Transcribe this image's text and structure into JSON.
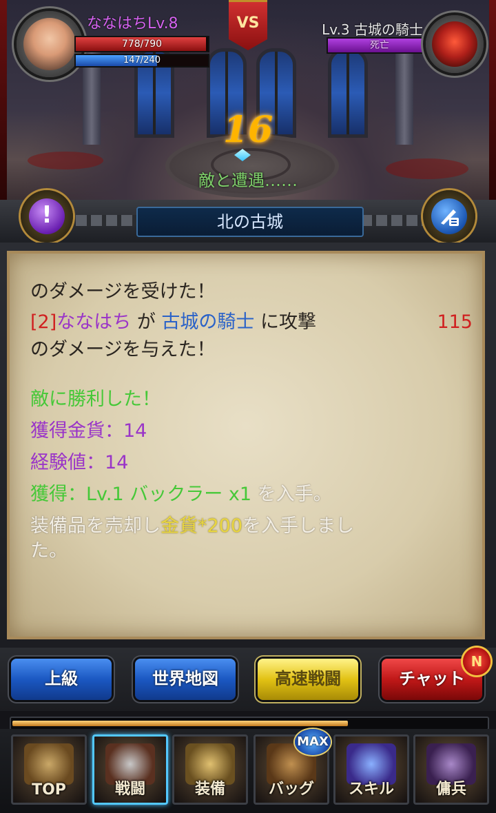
{
  "player": {
    "name": "ななはちLv.8",
    "hp_text": "778/790",
    "hp_ratio": 0.985,
    "mp_text": "147/240",
    "mp_ratio": 0.6125
  },
  "enemy": {
    "name": "Lv.3 古城の騎士",
    "status": "死亡",
    "hp_ratio": 1.0
  },
  "vs_label": "VS",
  "turn_counter": "16",
  "status_text": "敵と遭遇……",
  "location": "北の古城",
  "log": {
    "line1": "のダメージを受けた！",
    "attack_index": "[2]",
    "attacker": "ななはち",
    "ga": " が ",
    "target": "古城の騎士",
    "ni_kougeki": " に攻撃",
    "damage": "115",
    "line3": "のダメージを与えた！",
    "victory": "敵に勝利した！",
    "gold_gain": "獲得金貨：14",
    "exp_gain": "経験値：14",
    "item_gain": "獲得：Lv.1 バックラー x1",
    "item_suffix": " を入手。",
    "sell_prefix": "装備品を売却し",
    "sell_gold": "金貨*200",
    "sell_suffix": "を入手しまし",
    "sell_end": "た。"
  },
  "actions": {
    "advanced": "上級",
    "world_map": "世界地図",
    "fast_battle": "高速戦闘",
    "chat": "チャット",
    "chat_badge": "N"
  },
  "xp_ratio": 0.71,
  "nav": {
    "top": "TOP",
    "battle": "戦闘",
    "equip": "装備",
    "bag": "バッグ",
    "skill": "スキル",
    "mercenary": "傭兵",
    "bag_badge": "MAX"
  },
  "colors": {
    "player_name": "#d563f0",
    "damage": "#d02020",
    "attacker": "#9a35c8",
    "target": "#2a62c8",
    "victory": "#46c838",
    "gold": "#e9d640",
    "turn_counter": "#ffb400"
  },
  "icons": {
    "alert": "exclamation-icon",
    "quest": "quill-scroll-icon"
  }
}
